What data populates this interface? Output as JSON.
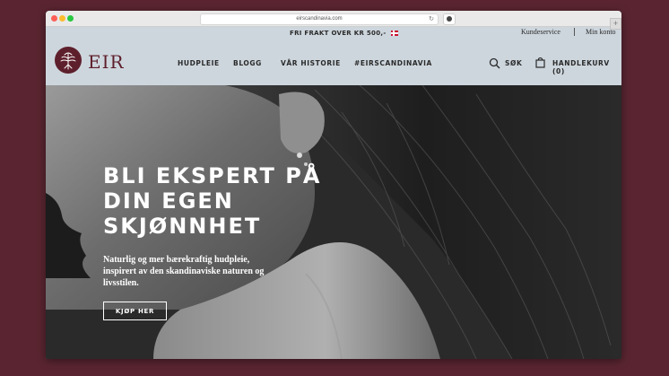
{
  "browser": {
    "url": "eirscandinavia.com"
  },
  "promo": {
    "text": "FRI FRAKT OVER KR 500,-",
    "emoji": "🇳🇴"
  },
  "toplinks": {
    "customer_service": "Kundeservice",
    "my_account": "Min konto"
  },
  "logo": {
    "text": "EIR"
  },
  "nav": {
    "items": [
      "HUDPLEIE",
      "BLOGG",
      "VÅR HISTORIE",
      "#EIRSCANDINAVIA"
    ],
    "search_label": "SØK",
    "cart_label": "HANDLEKURV (0)"
  },
  "hero": {
    "headline_lines": [
      "BLI EKSPERT PÅ",
      "DIN EGEN",
      "SKJØNNHET"
    ],
    "subtext_lines": [
      "Naturlig og mer bærekraftig hudpleie,",
      "inspirert av den skandinaviske naturen og",
      "livsstilen."
    ],
    "cta_label": "KJØP HER"
  },
  "colors": {
    "background": "#5a2531",
    "header_bg": "#cdd6dd",
    "brand": "#5e1f2c",
    "text_dark": "#2a2a2a"
  }
}
